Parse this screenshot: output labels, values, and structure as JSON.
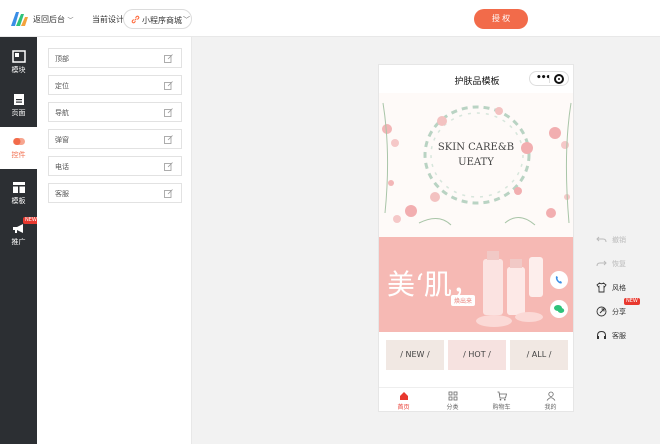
{
  "header": {
    "back_label": "返回后台",
    "current_design_label": "当前设计",
    "mini_program_select": "小程序商城",
    "authorize_label": "授 权"
  },
  "sidebar": {
    "items": [
      {
        "label": "模块",
        "icon": "module-icon"
      },
      {
        "label": "页面",
        "icon": "page-icon"
      },
      {
        "label": "控件",
        "icon": "widget-icon",
        "active": true
      },
      {
        "label": "模板",
        "icon": "template-icon"
      },
      {
        "label": "推广",
        "icon": "megaphone-icon",
        "badge": "NEW"
      }
    ]
  },
  "components": [
    {
      "label": "顶部"
    },
    {
      "label": "定位"
    },
    {
      "label": "导航"
    },
    {
      "label": "弹窗"
    },
    {
      "label": "电话"
    },
    {
      "label": "客服"
    }
  ],
  "phone": {
    "title": "护肤品模板",
    "hero_text": "SKIN CARE&BEAUTY",
    "hero_line1": "SKIN CARE&B",
    "hero_line2": "UEATY",
    "banner_big_text": "美‘肌，",
    "banner_small_text": "焕出来",
    "categories": [
      "/ NEW /",
      "/ HOT /",
      "/ ALL /"
    ],
    "tabs": [
      {
        "label": "首页",
        "icon": "home-icon",
        "active": true
      },
      {
        "label": "分类",
        "icon": "category-icon"
      },
      {
        "label": "购物车",
        "icon": "cart-icon"
      },
      {
        "label": "我的",
        "icon": "user-icon"
      }
    ]
  },
  "tools": [
    {
      "label": "撤销",
      "icon": "undo-icon",
      "disabled": true
    },
    {
      "label": "恢复",
      "icon": "redo-icon",
      "disabled": true
    },
    {
      "label": "风格",
      "icon": "shirt-icon"
    },
    {
      "label": "分享",
      "icon": "share-icon",
      "badge": "NEW"
    },
    {
      "label": "客服",
      "icon": "headset-icon"
    }
  ],
  "colors": {
    "accent": "#f26b4a",
    "sidebar_bg": "#2c2f33",
    "banner_pink": "#f7b5b0",
    "tab_active": "#e8382e"
  }
}
